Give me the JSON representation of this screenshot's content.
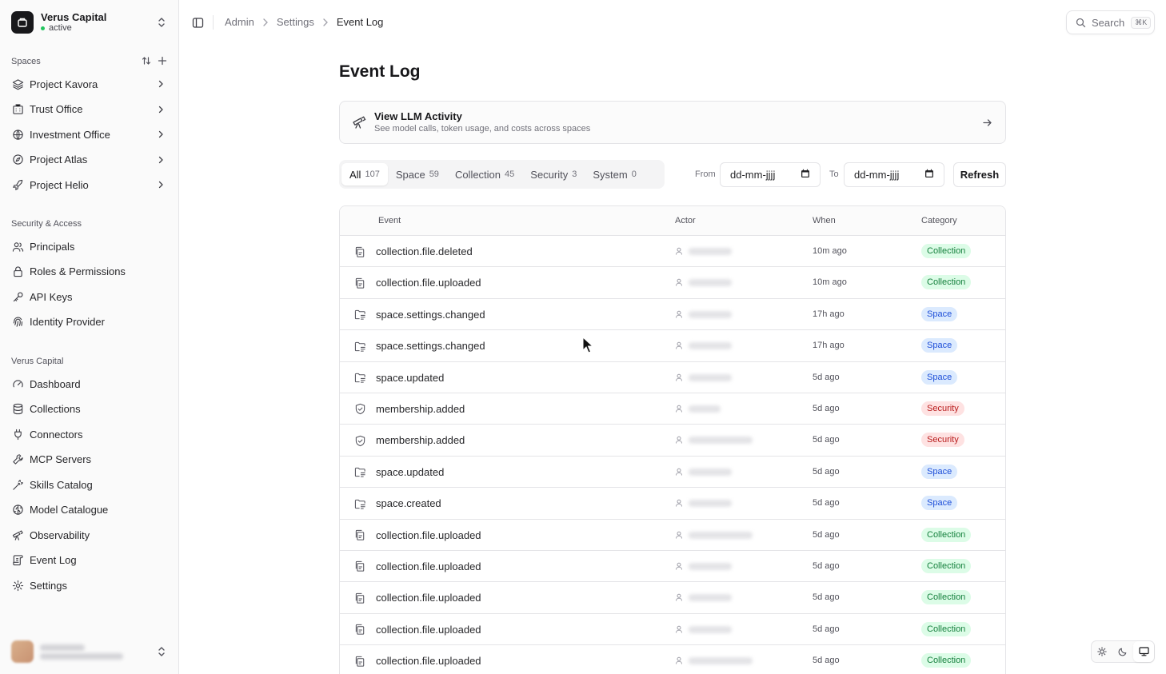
{
  "workspace": {
    "name": "Verus Capital",
    "status": "active",
    "status_color": "#22c55e"
  },
  "spaces": {
    "label": "Spaces",
    "items": [
      {
        "label": "Project Kavora",
        "icon": "layers-icon"
      },
      {
        "label": "Trust Office",
        "icon": "building-icon"
      },
      {
        "label": "Investment Office",
        "icon": "globe-icon"
      },
      {
        "label": "Project Atlas",
        "icon": "compass-icon"
      },
      {
        "label": "Project Helio",
        "icon": "rocket-icon"
      }
    ]
  },
  "security_access": {
    "label": "Security & Access",
    "items": [
      {
        "label": "Principals",
        "icon": "users-icon"
      },
      {
        "label": "Roles & Permissions",
        "icon": "lock-icon"
      },
      {
        "label": "API Keys",
        "icon": "key-icon"
      },
      {
        "label": "Identity Provider",
        "icon": "fingerprint-icon"
      }
    ]
  },
  "org_section": {
    "label": "Verus Capital",
    "items": [
      {
        "label": "Dashboard",
        "icon": "gauge-icon"
      },
      {
        "label": "Collections",
        "icon": "database-icon"
      },
      {
        "label": "Connectors",
        "icon": "plug-icon"
      },
      {
        "label": "MCP Servers",
        "icon": "wrench-icon"
      },
      {
        "label": "Skills Catalog",
        "icon": "wand-icon"
      },
      {
        "label": "Model Catalogue",
        "icon": "brain-icon"
      },
      {
        "label": "Observability",
        "icon": "telescope-icon"
      },
      {
        "label": "Event Log",
        "icon": "scroll-icon"
      },
      {
        "label": "Settings",
        "icon": "gear-icon"
      }
    ]
  },
  "breadcrumb": {
    "items": [
      "Admin",
      "Settings"
    ],
    "current": "Event Log"
  },
  "search": {
    "label": "Search",
    "shortcut": "⌘K"
  },
  "page": {
    "title": "Event Log"
  },
  "llm_card": {
    "title": "View LLM Activity",
    "subtitle": "See model calls, token usage, and costs across spaces"
  },
  "tabs": [
    {
      "label": "All",
      "count": "107",
      "active": true
    },
    {
      "label": "Space",
      "count": "59",
      "active": false
    },
    {
      "label": "Collection",
      "count": "45",
      "active": false
    },
    {
      "label": "Security",
      "count": "3",
      "active": false
    },
    {
      "label": "System",
      "count": "0",
      "active": false
    }
  ],
  "filters": {
    "from_label": "From",
    "to_label": "To",
    "from_value": "dd-mm-jjjj",
    "to_value": "dd-mm-jjjj",
    "refresh_label": "Refresh"
  },
  "table": {
    "columns": [
      "Event",
      "Actor",
      "When",
      "Category"
    ],
    "rows": [
      {
        "event": "collection.file.deleted",
        "when": "10m ago",
        "category": "Collection"
      },
      {
        "event": "collection.file.uploaded",
        "when": "10m ago",
        "category": "Collection"
      },
      {
        "event": "space.settings.changed",
        "when": "17h ago",
        "category": "Space"
      },
      {
        "event": "space.settings.changed",
        "when": "17h ago",
        "category": "Space"
      },
      {
        "event": "space.updated",
        "when": "5d ago",
        "category": "Space"
      },
      {
        "event": "membership.added",
        "when": "5d ago",
        "category": "Security"
      },
      {
        "event": "membership.added",
        "when": "5d ago",
        "category": "Security"
      },
      {
        "event": "space.updated",
        "when": "5d ago",
        "category": "Space"
      },
      {
        "event": "space.created",
        "when": "5d ago",
        "category": "Space"
      },
      {
        "event": "collection.file.uploaded",
        "when": "5d ago",
        "category": "Collection"
      },
      {
        "event": "collection.file.uploaded",
        "when": "5d ago",
        "category": "Collection"
      },
      {
        "event": "collection.file.uploaded",
        "when": "5d ago",
        "category": "Collection"
      },
      {
        "event": "collection.file.uploaded",
        "when": "5d ago",
        "category": "Collection"
      },
      {
        "event": "collection.file.uploaded",
        "when": "5d ago",
        "category": "Collection"
      }
    ]
  },
  "category_colors": {
    "Collection": {
      "bg": "#dcfce7",
      "fg": "#15803d"
    },
    "Space": {
      "bg": "#dbeafe",
      "fg": "#1d4ed8"
    },
    "Security": {
      "bg": "#fee2e2",
      "fg": "#b91c1c"
    }
  }
}
